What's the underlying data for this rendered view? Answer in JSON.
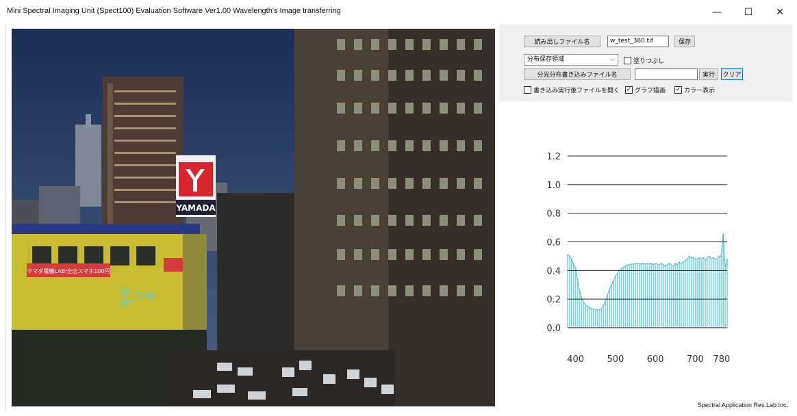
{
  "window": {
    "title": "Mini Spectral Imaging Unit (Spect100) Evaluation Software Ver1.00 Wavelength's Image transferring",
    "min_glyph": "—",
    "max_glyph": "☐",
    "close_glyph": "✕"
  },
  "photo": {
    "store_sign": "YAMADA",
    "banner_text": "ヤマダ電機LABI全店スマホ100円",
    "markers": [
      "1",
      "2",
      "3"
    ]
  },
  "controls": {
    "read_file_button": "読み出しファイル名",
    "file_name_value": "w_test_380.tif",
    "save_button": "保存",
    "region_select_value": "分布保存領域",
    "fill_checkbox_label": "塗りつぶし",
    "fill_checked": false,
    "spectral_write_button": "分光分布書き込みファイル名",
    "spectral_file_value": "",
    "run_button": "実行",
    "clear_button": "クリア",
    "open_after_label": "書き込み実行後ファイルを開く",
    "open_after_checked": false,
    "graph_draw_label": "グラフ描画",
    "graph_draw_checked": true,
    "color_display_label": "カラー表示",
    "color_display_checked": true
  },
  "chart_data": {
    "type": "bar",
    "xlabel": "",
    "ylabel": "",
    "xlim": [
      380,
      780
    ],
    "ylim": [
      0,
      1.2
    ],
    "yticks": [
      "1.2",
      "1.0",
      "0.8",
      "0.6",
      "0.4",
      "0.2",
      "0.0"
    ],
    "xticks": [
      "400",
      "500",
      "600",
      "700",
      "780"
    ],
    "grid": true,
    "bar_color": "#7fd3dc",
    "line_color": "#49b6c2",
    "x": [
      380,
      385,
      390,
      395,
      400,
      405,
      410,
      415,
      420,
      425,
      430,
      435,
      440,
      445,
      450,
      455,
      460,
      465,
      470,
      475,
      480,
      485,
      490,
      495,
      500,
      505,
      510,
      515,
      520,
      525,
      530,
      535,
      540,
      545,
      550,
      555,
      560,
      565,
      570,
      575,
      580,
      585,
      590,
      595,
      600,
      605,
      610,
      615,
      620,
      625,
      630,
      635,
      640,
      645,
      650,
      655,
      660,
      665,
      670,
      675,
      680,
      685,
      690,
      695,
      700,
      705,
      710,
      715,
      720,
      725,
      730,
      735,
      740,
      745,
      750,
      755,
      760,
      765,
      770,
      775,
      780
    ],
    "values": [
      0.51,
      0.5,
      0.48,
      0.44,
      0.42,
      0.33,
      0.26,
      0.21,
      0.18,
      0.16,
      0.15,
      0.14,
      0.135,
      0.13,
      0.125,
      0.125,
      0.13,
      0.135,
      0.16,
      0.19,
      0.23,
      0.27,
      0.3,
      0.33,
      0.36,
      0.38,
      0.4,
      0.415,
      0.425,
      0.43,
      0.44,
      0.44,
      0.445,
      0.445,
      0.45,
      0.45,
      0.45,
      0.445,
      0.45,
      0.445,
      0.45,
      0.445,
      0.45,
      0.44,
      0.45,
      0.445,
      0.44,
      0.45,
      0.44,
      0.43,
      0.44,
      0.45,
      0.44,
      0.43,
      0.45,
      0.44,
      0.46,
      0.45,
      0.46,
      0.47,
      0.48,
      0.5,
      0.49,
      0.49,
      0.48,
      0.48,
      0.49,
      0.48,
      0.49,
      0.47,
      0.49,
      0.5,
      0.48,
      0.49,
      0.48,
      0.48,
      0.5,
      0.5,
      0.66,
      0.42,
      0.48
    ]
  },
  "footer": {
    "credit": "Spectral Application Res.Lab.Inc."
  }
}
